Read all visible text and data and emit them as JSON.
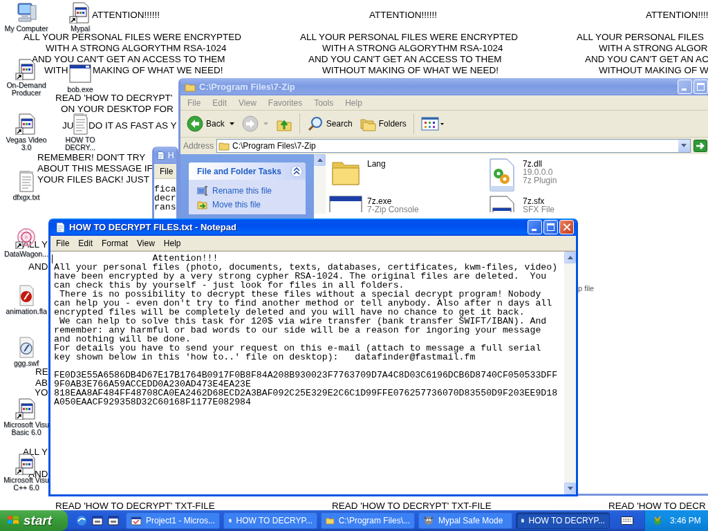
{
  "wallpaper_texts": [
    "ATTENTION!!!!!!",
    "ALL YOUR PERSONAL FILES WERE ENCRYPTED",
    "WITH A STRONG ALGORYTHM RSA-1024",
    "AND YOU CAN'T GET AN ACCESS TO THEM",
    "WITH",
    "MAKING OF WHAT WE NEED!",
    "READ 'HOW TO DECRYPT'",
    "ON YOUR DESKTOP FOR",
    "JU",
    "DO IT AS FAST AS Y",
    "REMEMBER! DON'T TRY",
    "ABOUT THIS MESSAGE IF",
    "YOUR FILES BACK! JUST",
    "ATTENTION!!!!!!",
    "ALL YOUR PERSONAL FILES WERE ENCRYPTED",
    "WITH A STRONG ALGORYTHM RSA-1024",
    "AND YOU CAN'T GET AN ACCESS TO THEM",
    "WITHOUT MAKING OF WHAT WE NEED!",
    "ATTENTION!!!!",
    "ALL YOUR PERSONAL FILES",
    "WITH A STRONG ALGOR",
    "AND YOU CAN'T GET AN AC",
    "WITHOUT MAKING OF W",
    "ALL Y",
    "AND",
    "RE",
    "AB",
    "YO",
    "ALL Y",
    "AND",
    "READ 'HOW TO DECRYPT' TXT-FILE",
    "READ 'HOW TO DECRYPT' TXT-FILE",
    "READ 'HOW TO DECR"
  ],
  "desktop_icons": [
    {
      "label": "My Computer",
      "kind": "computer",
      "shortcut": false
    },
    {
      "label": "Mypal",
      "kind": "program",
      "shortcut": true
    },
    {
      "label": "On-Demand\nProducer",
      "kind": "program",
      "shortcut": true
    },
    {
      "label": "bob.exe",
      "kind": "window",
      "shortcut": false
    },
    {
      "label": "Vegas Video\n3.0",
      "kind": "program",
      "shortcut": true
    },
    {
      "label": "HOW TO\nDECRY...",
      "kind": "text",
      "shortcut": false
    },
    {
      "label": "dfxgx.txt",
      "kind": "text",
      "shortcut": false
    },
    {
      "label": "DataWagon...",
      "kind": "flower",
      "shortcut": true
    },
    {
      "label": "animation.fla",
      "kind": "fla",
      "shortcut": false
    },
    {
      "label": "ggg.swf",
      "kind": "swf",
      "shortcut": false
    },
    {
      "label": "Microsoft Visu\nBasic 6.0",
      "kind": "program",
      "shortcut": true
    },
    {
      "label": "Microsoft Visu\nC++ 6.0",
      "kind": "program",
      "shortcut": true
    }
  ],
  "background_window": {
    "title": "H",
    "menu": [
      "File"
    ],
    "text_lines": [
      "fica",
      "decr",
      "rans"
    ]
  },
  "explorer": {
    "title": "C:\\Program Files\\7-Zip",
    "menu": [
      "File",
      "Edit",
      "View",
      "Favorites",
      "Tools",
      "Help"
    ],
    "toolbar": {
      "back": "Back",
      "search": "Search",
      "folders": "Folders"
    },
    "address_label": "Address",
    "address": "C:\\Program Files\\7-Zip",
    "tasks_panel": {
      "title": "File and Folder Tasks",
      "items": [
        "Rename this file",
        "Move this file"
      ]
    },
    "files": [
      {
        "kind": "folder",
        "lines": [
          "Lang"
        ]
      },
      {
        "kind": "dll",
        "lines": [
          "7z.dll",
          "19.0.0.0",
          "7z Plugin"
        ]
      },
      {
        "kind": "exe",
        "lines": [
          "7z.exe",
          "7-Zip Console"
        ]
      },
      {
        "kind": "sfx",
        "lines": [
          "7z.sfx",
          "SFX File"
        ]
      }
    ],
    "fragment": "p file"
  },
  "notepad": {
    "title": "HOW TO DECRYPT FILES.txt - Notepad",
    "menu": [
      "File",
      "Edit",
      "Format",
      "View",
      "Help"
    ],
    "message_lines": [
      "                  Attention!!!",
      "All your personal files (photo, documents, texts, databases, certificates, kwm-files, video)",
      "have been encrypted by a very strong cypher RSA-1024. The original files are deleted.  You",
      "can check this by yourself - just look for files in all folders.",
      " There is no possibility to decrypt these files without a special decrypt program! Nobody",
      "can help you - even don't try to find another method or tell anybody. Also after n days all",
      "encrypted files will be completely deleted and you will have no chance to get it back.",
      " We can help to solve this task for 120$ via wire transfer (bank transfer SWIFT/IBAN). And",
      "remember: any harmful or bad words to our side will be a reason for ingoring your message",
      "and nothing will be done.",
      "For details you have to send your request on this e-mail (attach to message a full serial",
      "key shown below in this 'how to..' file on desktop):   datafinder@fastmail.fm"
    ],
    "key_lines": [
      "FE0D3E55A6586DB4D67E17B1764B0917F0B8F84A208B930023F7763709D7A4C8D03C6196DCB6D8740CF050533DFF",
      "9F0AB3E766A59ACCEDD0A230AD473E4EA23E",
      "818EAA8AF484FF48708CA0EA2462D68ECD2A3BAF092C25E329E2C6C1D99FFE076257736070D83550D9F203EE9D18",
      "A050EAACF929358D32C60168F1177E082984"
    ]
  },
  "taskbar": {
    "start": "start",
    "tasks": [
      {
        "kind": "vb",
        "label": "Project1 - Micros...",
        "selected": false
      },
      {
        "kind": "notepad",
        "label": "HOW TO DECRYP...",
        "selected": false
      },
      {
        "kind": "folder",
        "label": "C:\\Program Files\\...",
        "selected": false
      },
      {
        "kind": "mypal",
        "label": "Mypal Safe Mode",
        "selected": false
      },
      {
        "kind": "notepad",
        "label": "HOW TO DECRYP...",
        "selected": true
      }
    ],
    "clock": "3:46 PM"
  }
}
